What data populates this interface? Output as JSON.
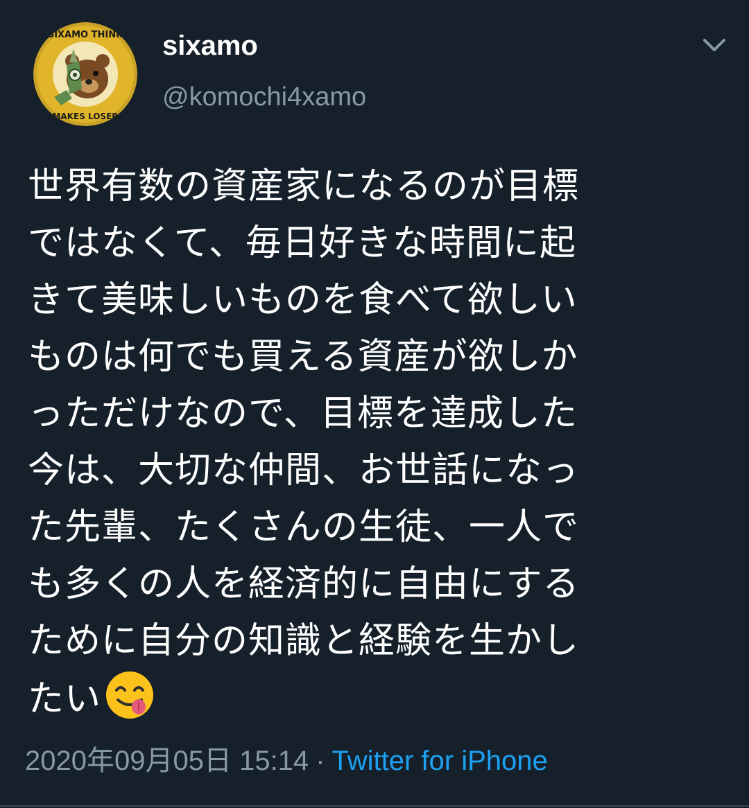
{
  "tweet": {
    "author": {
      "display_name": "sixamo",
      "handle": "@komochi4xamo",
      "avatar_text_top": "SIXAMO THINK",
      "avatar_text_bottom": "MAKES LOSER"
    },
    "text_lines": [
      "世界有数の資産家になるのが目標",
      "ではなくて、毎日好きな時間に起",
      "きて美味しいものを食べて欲しい",
      "ものは何でも買える資産が欲しか",
      "っただけなので、目標を達成した",
      "今は、大切な仲間、お世話になっ",
      "た先輩、たくさんの生徒、一人で",
      "も多くの人を経済的に自由にする",
      "ために自分の知識と経験を生かし",
      "たい"
    ],
    "emoji": "face-savoring-food",
    "timestamp": "2020年09月05日 15:14",
    "separator": "·",
    "source": "Twitter for iPhone"
  },
  "colors": {
    "background": "#15202b",
    "text": "#ffffff",
    "secondary": "#8899a6",
    "link": "#1da1f2",
    "divider": "#38444d"
  },
  "icons": {
    "menu": "chevron-down-icon",
    "avatar": "bear-logo"
  }
}
